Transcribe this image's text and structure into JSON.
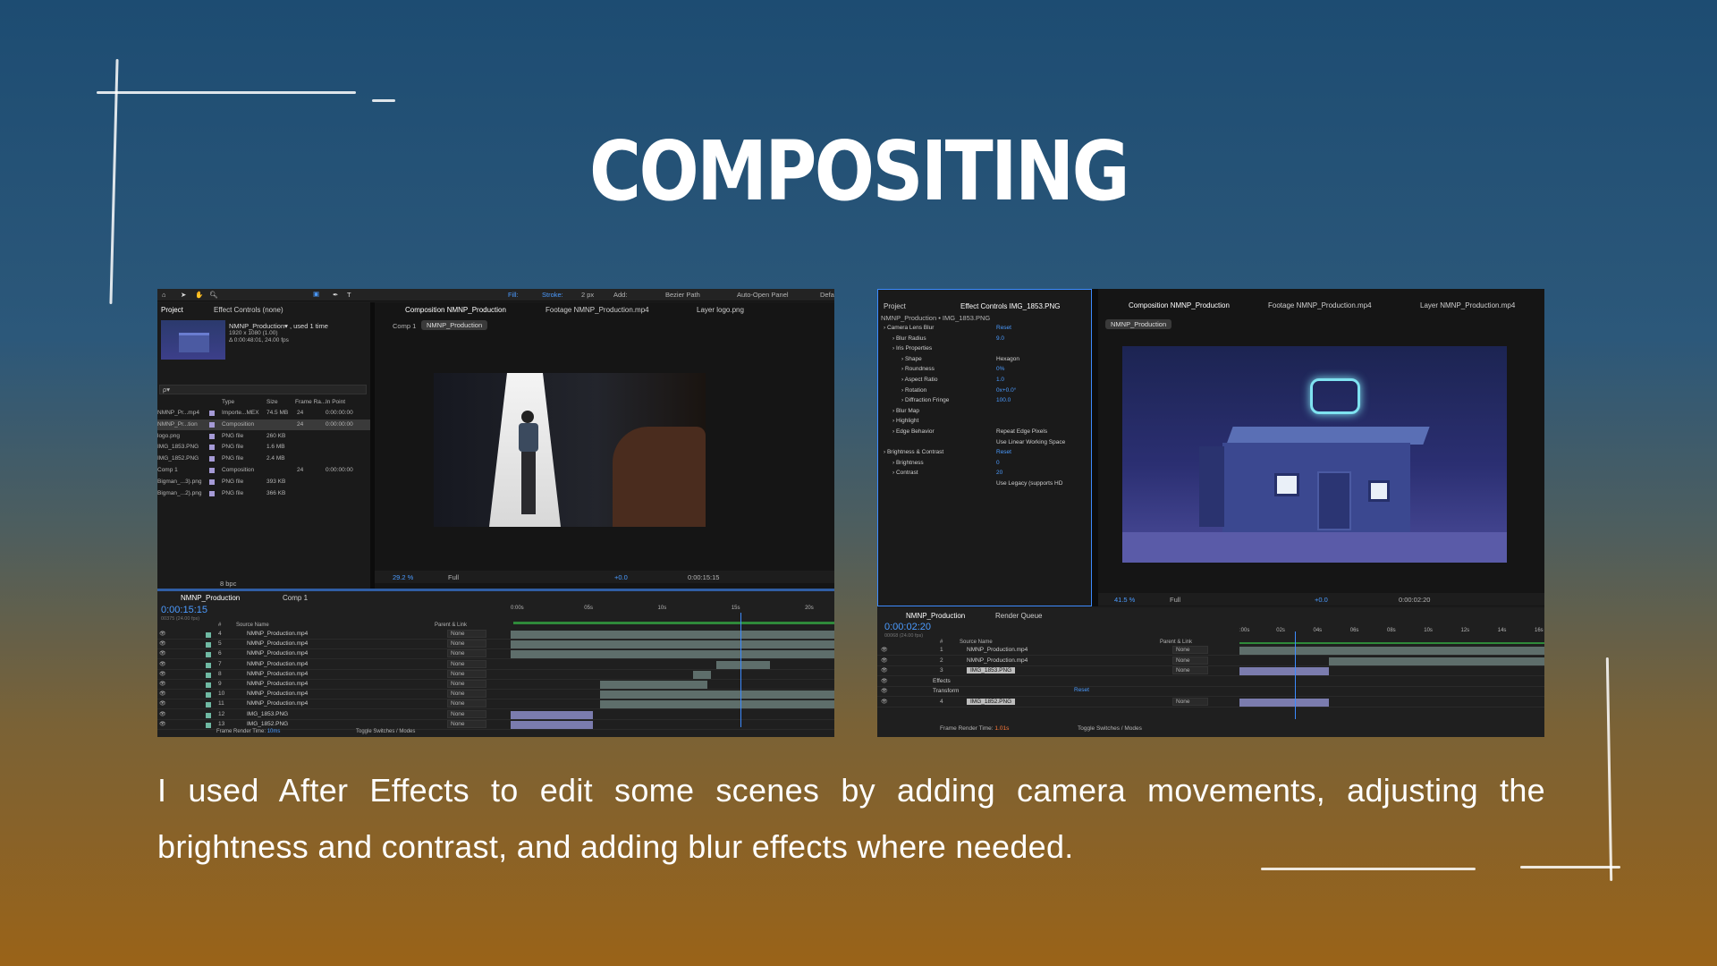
{
  "title": "COMPOSITING",
  "caption": "I used After Effects to edit some scenes by adding camera movements, adjusting the brightness and contrast, and adding blur effects where needed.",
  "colors": {
    "accent_blue": "#3d8bff",
    "chalk": "#ffffff"
  },
  "left_screenshot": {
    "toolbar": {
      "fill": "Fill:",
      "stroke": "Stroke:",
      "stroke_px": "2 px",
      "add": "Add:",
      "bezier": "Bezier Path",
      "auto_open": "Auto-Open Panel",
      "default": "Defa"
    },
    "project_tab": "Project",
    "effect_controls_tab": "Effect Controls (none)",
    "comp_info": [
      "NMNP_Production▾ , used 1 time",
      "1920 x 1080 (1.00)",
      "Δ 0:00:48:01, 24.00 fps"
    ],
    "search_placeholder": "ρ▾",
    "columns": [
      "Type",
      "Size",
      "Frame Ra...",
      "In Point"
    ],
    "files": [
      {
        "name": "NMNP_Pr...mp4",
        "type": "Importe...MEX",
        "size": "74.5 MB",
        "fps": "24",
        "in": "0:00:00:00"
      },
      {
        "name": "NMNP_Pr...tion",
        "type": "Composition",
        "size": "",
        "fps": "24",
        "in": "0:00:00:00"
      },
      {
        "name": "logo.png",
        "type": "PNG file",
        "size": "260 KB",
        "fps": "",
        "in": ""
      },
      {
        "name": "IMG_1853.PNG",
        "type": "PNG file",
        "size": "1.6 MB",
        "fps": "",
        "in": ""
      },
      {
        "name": "IMG_1852.PNG",
        "type": "PNG file",
        "size": "2.4 MB",
        "fps": "",
        "in": ""
      },
      {
        "name": "Comp 1",
        "type": "Composition",
        "size": "",
        "fps": "24",
        "in": "0:00:00:00"
      },
      {
        "name": "Bigman_...3).png",
        "type": "PNG file",
        "size": "393 KB",
        "fps": "",
        "in": ""
      },
      {
        "name": "Bigman_...2).png",
        "type": "PNG file",
        "size": "366 KB",
        "fps": "",
        "in": ""
      }
    ],
    "bpc": "8 bpc",
    "viewer_tabs": [
      "Composition NMNP_Production",
      "Footage NMNP_Production.mp4",
      "Layer logo.png"
    ],
    "breadcrumbs": [
      "Comp 1",
      "NMNP_Production"
    ],
    "zoom": "29.2 %",
    "resolution": "Full",
    "exposure": "+0.0",
    "viewer_time": "0:00:15:15",
    "timeline_tabs": [
      "NMNP_Production",
      "Comp 1"
    ],
    "timecode": "0:00:15:15",
    "timecode_sub": "00375 (24.00 fps)",
    "layer_header": [
      "#",
      "Source Name",
      "Parent & Link"
    ],
    "layers": [
      {
        "num": "4",
        "name": "NMNP_Production.mp4",
        "parent": "None"
      },
      {
        "num": "5",
        "name": "NMNP_Production.mp4",
        "parent": "None"
      },
      {
        "num": "6",
        "name": "NMNP_Production.mp4",
        "parent": "None"
      },
      {
        "num": "7",
        "name": "NMNP_Production.mp4",
        "parent": "None"
      },
      {
        "num": "8",
        "name": "NMNP_Production.mp4",
        "parent": "None"
      },
      {
        "num": "9",
        "name": "NMNP_Production.mp4",
        "parent": "None"
      },
      {
        "num": "10",
        "name": "NMNP_Production.mp4",
        "parent": "None"
      },
      {
        "num": "11",
        "name": "NMNP_Production.mp4",
        "parent": "None"
      },
      {
        "num": "12",
        "name": "IMG_1853.PNG",
        "parent": "None"
      },
      {
        "num": "13",
        "name": "IMG_1852.PNG",
        "parent": "None"
      }
    ],
    "ruler": [
      "0:00s",
      "05s",
      "10s",
      "15s",
      "20s"
    ],
    "footer_left": "Frame Render Time:",
    "footer_left_value": "10ms",
    "footer_right": "Toggle Switches / Modes"
  },
  "right_screenshot": {
    "project_tab": "Project",
    "effect_controls_tab": "Effect Controls IMG_1853.PNG",
    "effect_target": "NMNP_Production • IMG_1853.PNG",
    "effects": [
      {
        "label": "Camera Lens Blur",
        "value": "Reset",
        "indent": 0
      },
      {
        "label": "Blur Radius",
        "value": "9.0",
        "indent": 1
      },
      {
        "label": "Iris Properties",
        "value": "",
        "indent": 1
      },
      {
        "label": "Shape",
        "value": "Hexagon",
        "indent": 2
      },
      {
        "label": "Roundness",
        "value": "0%",
        "indent": 2
      },
      {
        "label": "Aspect Ratio",
        "value": "1.0",
        "indent": 2
      },
      {
        "label": "Rotation",
        "value": "0x+0.0°",
        "indent": 2
      },
      {
        "label": "Diffraction Fringe",
        "value": "100.0",
        "indent": 2
      },
      {
        "label": "Blur Map",
        "value": "",
        "indent": 1
      },
      {
        "label": "Highlight",
        "value": "",
        "indent": 1
      },
      {
        "label": "Edge Behavior",
        "value": "Repeat Edge Pixels",
        "indent": 1
      },
      {
        "label": "",
        "value": "Use Linear Working Space",
        "indent": 1
      },
      {
        "label": "Brightness & Contrast",
        "value": "Reset",
        "indent": 0
      },
      {
        "label": "Brightness",
        "value": "0",
        "indent": 1
      },
      {
        "label": "Contrast",
        "value": "20",
        "indent": 1
      },
      {
        "label": "",
        "value": "Use Legacy (supports HD",
        "indent": 1
      }
    ],
    "viewer_tabs": [
      "Composition NMNP_Production",
      "Footage NMNP_Production.mp4",
      "Layer NMNP_Production.mp4"
    ],
    "breadcrumb": "NMNP_Production",
    "zoom": "41.5 %",
    "resolution": "Full",
    "exposure": "+0.0",
    "viewer_time": "0:00:02:20",
    "timeline_tabs": [
      "NMNP_Production",
      "Render Queue"
    ],
    "timecode": "0:00:02:20",
    "timecode_sub": "00068 (24.00 fps)",
    "layer_header": [
      "#",
      "Source Name",
      "Parent & Link"
    ],
    "layers": [
      {
        "num": "1",
        "name": "NMNP_Production.mp4",
        "parent": "None"
      },
      {
        "num": "2",
        "name": "NMNP_Production.mp4",
        "parent": "None"
      },
      {
        "num": "3",
        "name": "IMG_1853.PNG",
        "parent": "None"
      },
      {
        "num": "",
        "name": "Effects",
        "parent": ""
      },
      {
        "num": "",
        "name": "Transform",
        "parent": "Reset"
      },
      {
        "num": "4",
        "name": "IMG_1852.PNG",
        "parent": "None"
      }
    ],
    "ruler": [
      ":00s",
      "02s",
      "04s",
      "06s",
      "08s",
      "10s",
      "12s",
      "14s",
      "16s"
    ],
    "footer_left": "Frame Render Time:",
    "footer_left_value": "1.01s",
    "footer_right": "Toggle Switches / Modes"
  }
}
